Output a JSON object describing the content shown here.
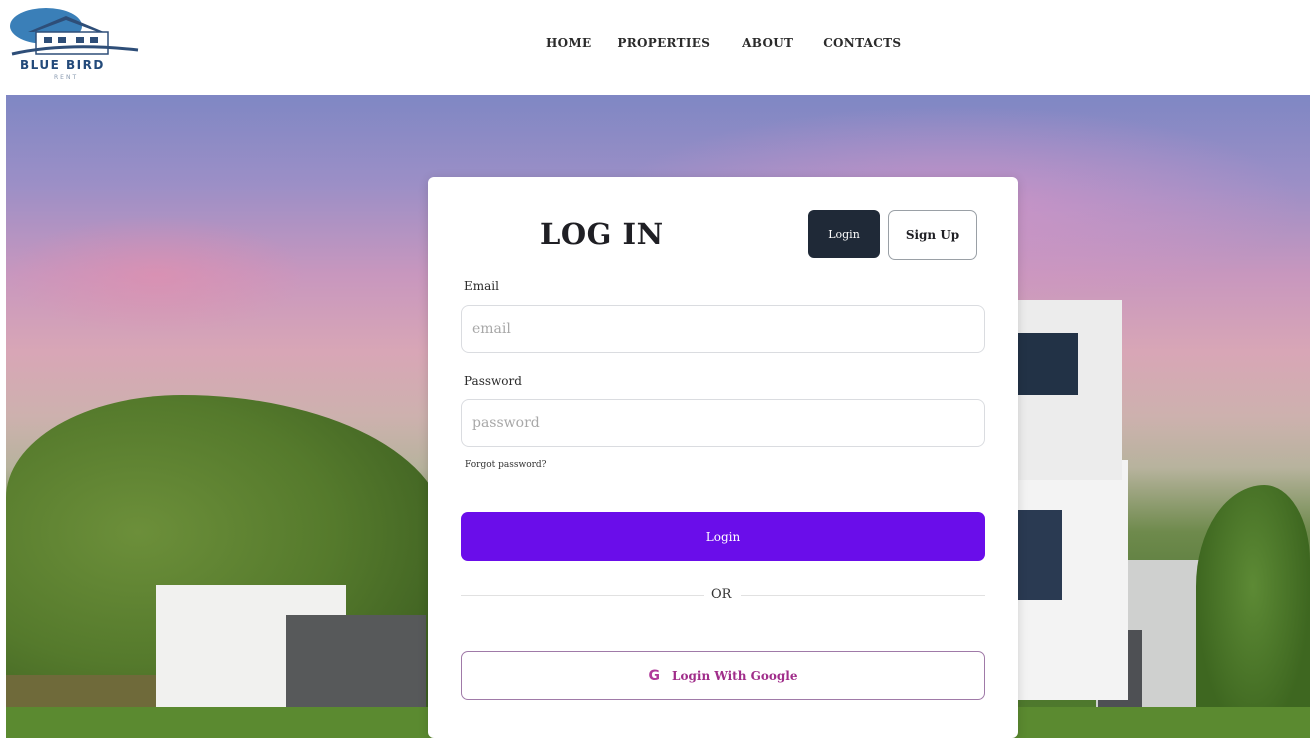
{
  "header": {
    "logo_text": "BLUE BIRD",
    "logo_sub": "RENT",
    "nav": [
      "HOME",
      "PROPERTIES",
      "ABOUT",
      "CONTACTS"
    ]
  },
  "card": {
    "title": "LOG IN",
    "tab_login": "Login",
    "tab_signup": "Sign Up",
    "email_label": "Email",
    "email_placeholder": "email",
    "password_label": "Password",
    "password_placeholder": "password",
    "forgot": "Forgot password?",
    "submit": "Login",
    "or": "OR",
    "google_icon": "G",
    "google_label": "Login With Google"
  },
  "colors": {
    "primary": "#6a0dea",
    "dark_tab": "#1f2937",
    "google_text": "#a02d8a",
    "logo_blue": "#234a7a"
  },
  "icons": {
    "logo": "house-logo-icon",
    "google": "google-icon"
  }
}
